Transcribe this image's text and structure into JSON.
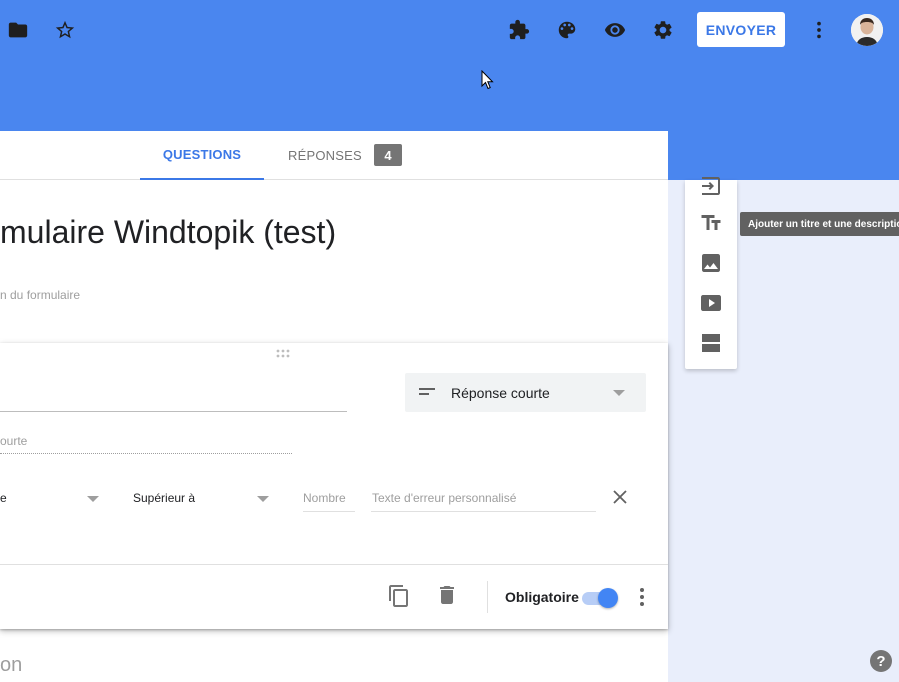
{
  "header": {
    "send_label": "ENVOYER",
    "icons": [
      "folder-icon",
      "star-icon",
      "puzzle-icon",
      "palette-icon",
      "eye-icon",
      "gear-icon",
      "more-vert-icon"
    ],
    "bg_color": "#4a86ef"
  },
  "tabs": {
    "questions": "QUESTIONS",
    "responses": "RÉPONSES",
    "responses_count": "4"
  },
  "form": {
    "title": "mulaire Windtopik (test)",
    "description_placeholder": "n du formulaire"
  },
  "question": {
    "type_label": "Réponse courte",
    "short_answer_placeholder": "ourte",
    "validation": {
      "first_value": "e",
      "condition": "Supérieur à",
      "number_placeholder": "Nombre",
      "error_placeholder": "Texte d'erreur personnalisé"
    },
    "required_label": "Obligatoire",
    "required": true
  },
  "next_question_fragment": "on",
  "side_tools": {
    "tooltip": "Ajouter un titre et une description"
  },
  "help_label": "?",
  "accent_color": "#3b78e7"
}
